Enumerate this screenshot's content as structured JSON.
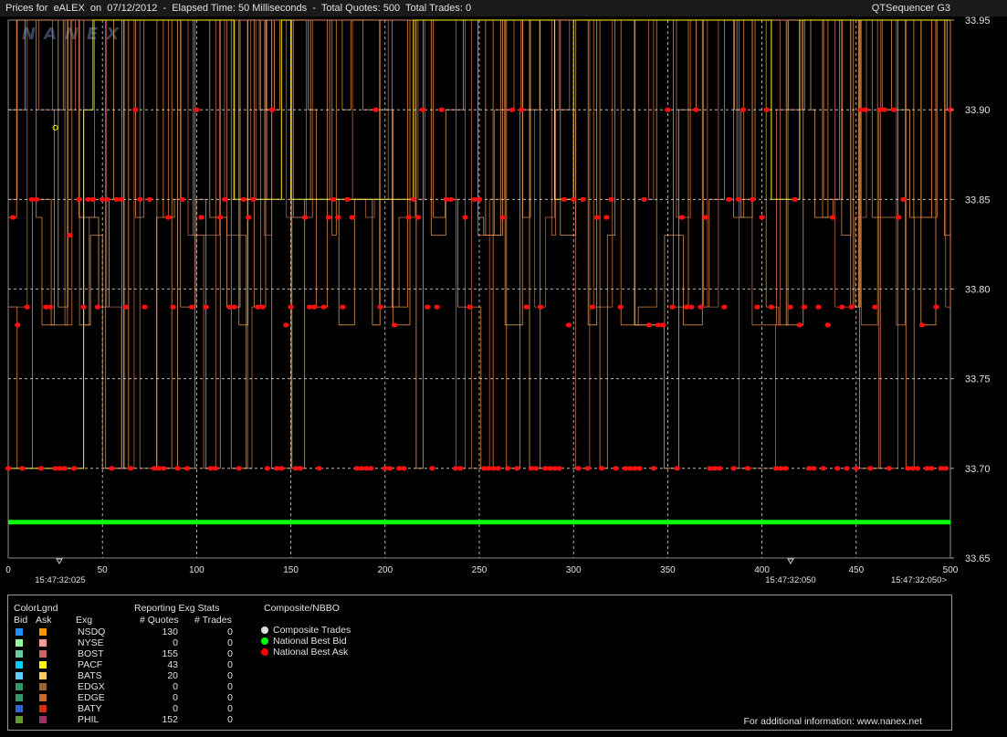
{
  "header": {
    "title": "Prices for  eALEX  on  07/12/2012  -  Elapsed Time: 50 Milliseconds  -  Total Quotes: 500  Total Trades: 0",
    "app": "QTSequencer G3"
  },
  "watermark": "NANEX",
  "chart_data": {
    "type": "line",
    "x": {
      "range": [
        0,
        500
      ],
      "ticks": [
        "0",
        "50",
        "100",
        "150",
        "200",
        "250",
        "300",
        "350",
        "400",
        "450",
        "500"
      ]
    },
    "y": {
      "range": [
        33.65,
        33.95
      ],
      "ticks": [
        "33.95",
        "33.90",
        "33.85",
        "33.80",
        "33.75",
        "33.70",
        "33.65"
      ]
    },
    "time_labels": [
      "15:47:32:025",
      "15:47:32:050",
      "15:47:32:050>"
    ],
    "national_best_bid": 33.67,
    "ask_levels": [
      33.9,
      33.85,
      33.84,
      33.83,
      33.79,
      33.78,
      33.7
    ],
    "series": [
      {
        "name": "National Best Bid",
        "color": "#00ff00"
      },
      {
        "name": "National Best Ask",
        "color": "#ff0000"
      }
    ],
    "grid": true
  },
  "legend": {
    "color_title": "ColorLgnd",
    "bid_label": "Bid",
    "ask_label": "Ask",
    "exg_label": "Exg",
    "stats_title": "Reporting Exg Stats",
    "quotes_label": "# Quotes",
    "trades_label": "# Trades",
    "composite_title": "Composite/NBBO",
    "exchanges": [
      {
        "name": "NSDQ",
        "quotes": "130",
        "trades": "0",
        "bid_color": "#1e90ff",
        "ask_color": "#ff9900"
      },
      {
        "name": "NYSE",
        "quotes": "0",
        "trades": "0",
        "bid_color": "#99ff99",
        "ask_color": "#ff9999"
      },
      {
        "name": "BOST",
        "quotes": "155",
        "trades": "0",
        "bid_color": "#66cc99",
        "ask_color": "#cc6666"
      },
      {
        "name": "PACF",
        "quotes": "43",
        "trades": "0",
        "bid_color": "#00ccff",
        "ask_color": "#ffff00"
      },
      {
        "name": "BATS",
        "quotes": "20",
        "trades": "0",
        "bid_color": "#66ccff",
        "ask_color": "#ffcc66"
      },
      {
        "name": "EDGX",
        "quotes": "0",
        "trades": "0",
        "bid_color": "#339966",
        "ask_color": "#996633"
      },
      {
        "name": "EDGE",
        "quotes": "0",
        "trades": "0",
        "bid_color": "#339966",
        "ask_color": "#cc6633"
      },
      {
        "name": "BATY",
        "quotes": "0",
        "trades": "0",
        "bid_color": "#3366cc",
        "ask_color": "#cc3300"
      },
      {
        "name": "PHIL",
        "quotes": "152",
        "trades": "0",
        "bid_color": "#669933",
        "ask_color": "#993366"
      }
    ],
    "composite_items": [
      {
        "label": "Composite Trades",
        "color": "#dddddd"
      },
      {
        "label": "National Best Bid",
        "color": "#00ff00"
      },
      {
        "label": "National Best Ask",
        "color": "#ff0000"
      }
    ],
    "footer": "For additional information: www.nanex.net"
  }
}
